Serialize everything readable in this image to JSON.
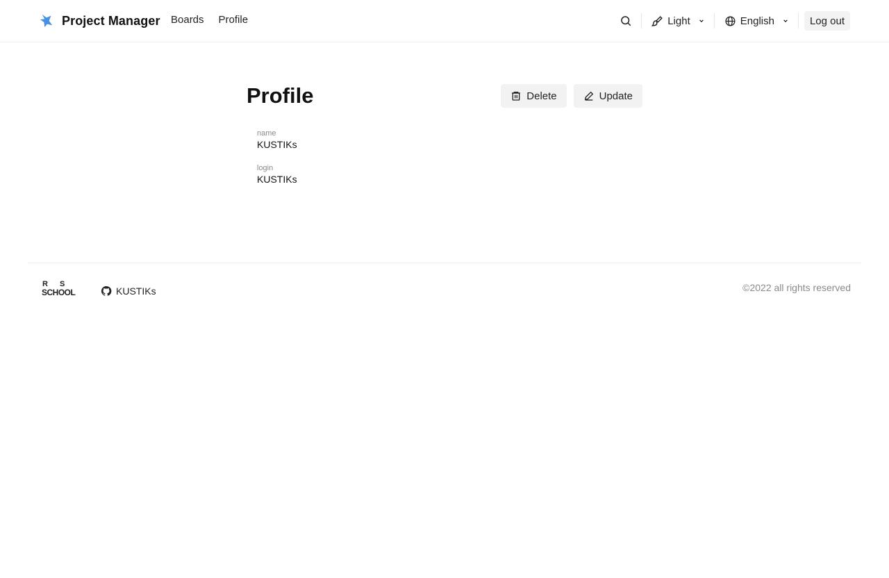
{
  "header": {
    "brand_title": "Project Manager",
    "nav": [
      {
        "label": "Boards"
      },
      {
        "label": "Profile"
      }
    ],
    "search_icon": "search-icon",
    "theme": {
      "icon": "brush-icon",
      "label": "Light"
    },
    "language": {
      "icon": "globe-icon",
      "label": "English"
    },
    "logout_label": "Log out"
  },
  "main": {
    "title": "Profile",
    "delete_label": "Delete",
    "update_label": "Update",
    "fields": [
      {
        "label": "name",
        "value": "KUSTIKs"
      },
      {
        "label": "login",
        "value": "KUSTIKs"
      }
    ]
  },
  "footer": {
    "logo_text": "RS SCHOOL",
    "github_label": "KUSTIKs",
    "copyright": "©2022 all rights reserved"
  },
  "colors": {
    "accent": "#4a90e2",
    "muted_text": "#8a8a8a",
    "button_bg": "#f2f2f2"
  }
}
